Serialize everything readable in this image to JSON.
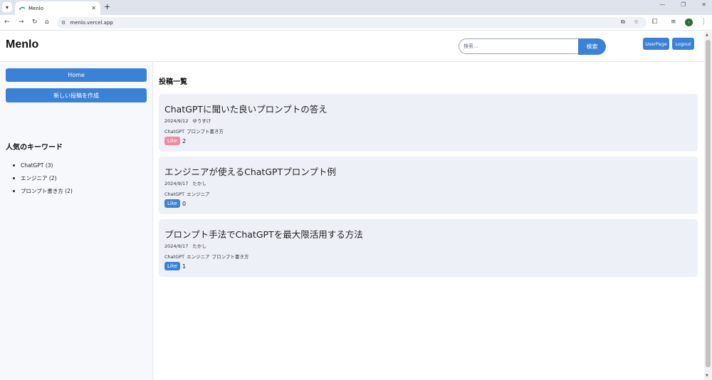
{
  "browser": {
    "tab_title": "Menlo",
    "url": "menlo.vercel.app"
  },
  "header": {
    "logo": "Menlo",
    "search_placeholder": "検索...",
    "search_button": "検索",
    "userpage_button": "UserPage",
    "logout_button": "Logout"
  },
  "sidebar": {
    "home_button": "Home",
    "new_post_button": "新しい投稿を作成",
    "keywords_title": "人気のキーワード",
    "keywords": [
      {
        "label": "ChatGPT (3)"
      },
      {
        "label": "エンジニア (2)"
      },
      {
        "label": "プロンプト書き方 (2)"
      }
    ]
  },
  "main": {
    "title": "投稿一覧",
    "posts": [
      {
        "title": "ChatGPTに聞いた良いプロンプトの答え",
        "date": "2024/9/12",
        "author": "ゆうすけ",
        "tags": [
          "ChatGPT",
          "プロンプト書き方"
        ],
        "like_label": "Like",
        "likes": "2",
        "liked": true
      },
      {
        "title": "エンジニアが使えるChatGPTプロンプト例",
        "date": "2024/9/17",
        "author": "たかし",
        "tags": [
          "ChatGPT",
          "エンジニア"
        ],
        "like_label": "Like",
        "likes": "0",
        "liked": false
      },
      {
        "title": "プロンプト手法でChatGPTを最大限活用する方法",
        "date": "2024/9/17",
        "author": "たかし",
        "tags": [
          "ChatGPT",
          "エンジニア",
          "プロンプト書き方"
        ],
        "like_label": "Like",
        "likes": "1",
        "liked": false
      }
    ]
  },
  "colors": {
    "accent": "#3b82d6",
    "liked": "#f08aa3",
    "card_bg": "#edf0f6",
    "sidebar_bg": "#f6f8fc"
  }
}
